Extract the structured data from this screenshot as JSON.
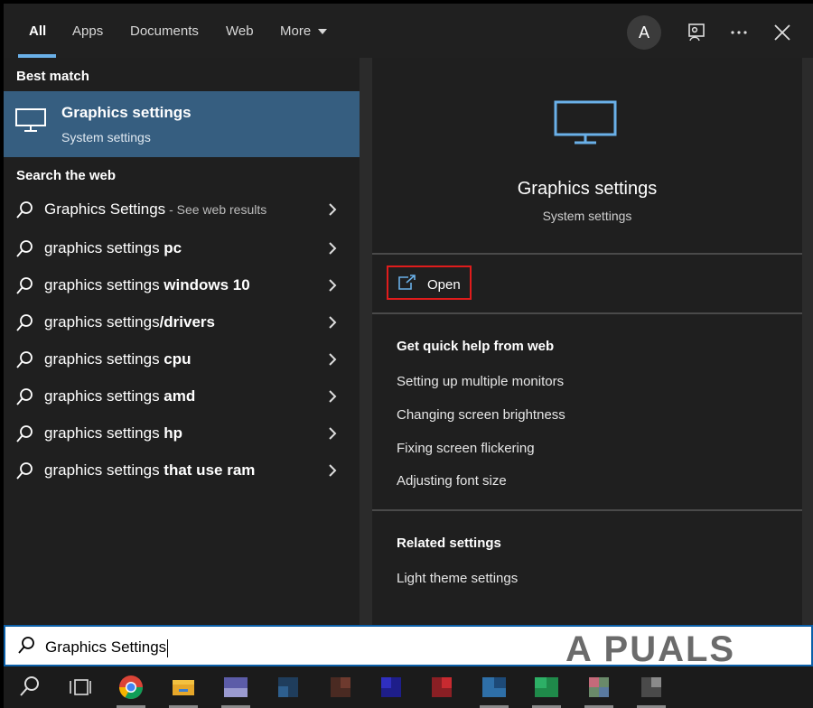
{
  "tabs": [
    {
      "label": "All",
      "active": true
    },
    {
      "label": "Apps"
    },
    {
      "label": "Documents"
    },
    {
      "label": "Web"
    },
    {
      "label": "More"
    }
  ],
  "account": {
    "initial": "A"
  },
  "left": {
    "best_match_heading": "Best match",
    "best_match": {
      "title": "Graphics settings",
      "subtitle": "System settings",
      "icon": "monitor-icon"
    },
    "web_heading": "Search the web",
    "web_results": [
      {
        "prefix": "Graphics Settings",
        "suffix": " - See web results"
      },
      {
        "prefix": "graphics settings ",
        "bold": "pc"
      },
      {
        "prefix": "graphics settings ",
        "bold": "windows 10"
      },
      {
        "prefix": "graphics settings",
        "bold": "/drivers"
      },
      {
        "prefix": "graphics settings ",
        "bold": "cpu"
      },
      {
        "prefix": "graphics settings ",
        "bold": "amd"
      },
      {
        "prefix": "graphics settings ",
        "bold": "hp"
      },
      {
        "prefix": "graphics settings ",
        "bold": "that use ram"
      }
    ]
  },
  "right": {
    "title": "Graphics settings",
    "subtitle": "System settings",
    "open_label": "Open",
    "quick_help_heading": "Get quick help from web",
    "quick_help_links": [
      "Setting up multiple monitors",
      "Changing screen brightness",
      "Fixing screen flickering",
      "Adjusting font size"
    ],
    "related_heading": "Related settings",
    "related_links": [
      "Light theme settings"
    ]
  },
  "search": {
    "value": "Graphics Settings"
  },
  "watermark": "A  PUALS",
  "colors": {
    "accent": "#6ab0e8",
    "selection": "#365e80",
    "highlight_box": "#e01c1c"
  }
}
